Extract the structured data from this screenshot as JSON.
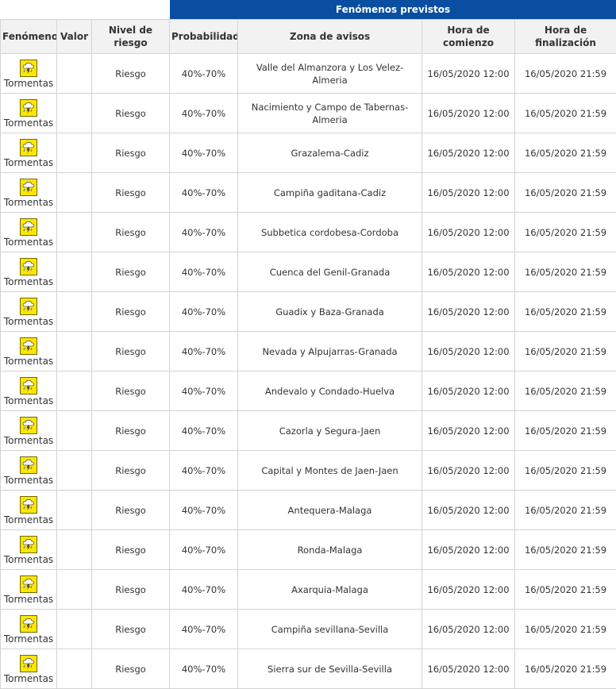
{
  "banner": {
    "title": "Fenómenos previstos"
  },
  "headers": {
    "fenomeno": "Fenómeno",
    "valor": "Valor",
    "nivel": "Nivel de riesgo",
    "probabilidad": "Probabilidad",
    "zona": "Zona de avisos",
    "comienzo": "Hora de comienzo",
    "finalizacion": "Hora de finalización"
  },
  "icon": {
    "name": "storm-icon",
    "color": "#ffe600"
  },
  "rows": [
    {
      "fenomeno": "Tormentas",
      "valor": "",
      "nivel": "Riesgo",
      "probabilidad": "40%-70%",
      "zona": "Valle del Almanzora y Los Velez-Almeria",
      "comienzo": "16/05/2020 12:00",
      "fin": "16/05/2020 21:59"
    },
    {
      "fenomeno": "Tormentas",
      "valor": "",
      "nivel": "Riesgo",
      "probabilidad": "40%-70%",
      "zona": "Nacimiento y Campo de Tabernas-Almeria",
      "comienzo": "16/05/2020 12:00",
      "fin": "16/05/2020 21:59"
    },
    {
      "fenomeno": "Tormentas",
      "valor": "",
      "nivel": "Riesgo",
      "probabilidad": "40%-70%",
      "zona": "Grazalema-Cadiz",
      "comienzo": "16/05/2020 12:00",
      "fin": "16/05/2020 21:59"
    },
    {
      "fenomeno": "Tormentas",
      "valor": "",
      "nivel": "Riesgo",
      "probabilidad": "40%-70%",
      "zona": "Campiña gaditana-Cadiz",
      "comienzo": "16/05/2020 12:00",
      "fin": "16/05/2020 21:59"
    },
    {
      "fenomeno": "Tormentas",
      "valor": "",
      "nivel": "Riesgo",
      "probabilidad": "40%-70%",
      "zona": "Subbetica cordobesa-Cordoba",
      "comienzo": "16/05/2020 12:00",
      "fin": "16/05/2020 21:59"
    },
    {
      "fenomeno": "Tormentas",
      "valor": "",
      "nivel": "Riesgo",
      "probabilidad": "40%-70%",
      "zona": "Cuenca del Genil-Granada",
      "comienzo": "16/05/2020 12:00",
      "fin": "16/05/2020 21:59"
    },
    {
      "fenomeno": "Tormentas",
      "valor": "",
      "nivel": "Riesgo",
      "probabilidad": "40%-70%",
      "zona": "Guadix y Baza-Granada",
      "comienzo": "16/05/2020 12:00",
      "fin": "16/05/2020 21:59"
    },
    {
      "fenomeno": "Tormentas",
      "valor": "",
      "nivel": "Riesgo",
      "probabilidad": "40%-70%",
      "zona": "Nevada y Alpujarras-Granada",
      "comienzo": "16/05/2020 12:00",
      "fin": "16/05/2020 21:59"
    },
    {
      "fenomeno": "Tormentas",
      "valor": "",
      "nivel": "Riesgo",
      "probabilidad": "40%-70%",
      "zona": "Andevalo y Condado-Huelva",
      "comienzo": "16/05/2020 12:00",
      "fin": "16/05/2020 21:59"
    },
    {
      "fenomeno": "Tormentas",
      "valor": "",
      "nivel": "Riesgo",
      "probabilidad": "40%-70%",
      "zona": "Cazorla y Segura-Jaen",
      "comienzo": "16/05/2020 12:00",
      "fin": "16/05/2020 21:59"
    },
    {
      "fenomeno": "Tormentas",
      "valor": "",
      "nivel": "Riesgo",
      "probabilidad": "40%-70%",
      "zona": "Capital y Montes de Jaen-Jaen",
      "comienzo": "16/05/2020 12:00",
      "fin": "16/05/2020 21:59"
    },
    {
      "fenomeno": "Tormentas",
      "valor": "",
      "nivel": "Riesgo",
      "probabilidad": "40%-70%",
      "zona": "Antequera-Malaga",
      "comienzo": "16/05/2020 12:00",
      "fin": "16/05/2020 21:59"
    },
    {
      "fenomeno": "Tormentas",
      "valor": "",
      "nivel": "Riesgo",
      "probabilidad": "40%-70%",
      "zona": "Ronda-Malaga",
      "comienzo": "16/05/2020 12:00",
      "fin": "16/05/2020 21:59"
    },
    {
      "fenomeno": "Tormentas",
      "valor": "",
      "nivel": "Riesgo",
      "probabilidad": "40%-70%",
      "zona": "Axarquia-Malaga",
      "comienzo": "16/05/2020 12:00",
      "fin": "16/05/2020 21:59"
    },
    {
      "fenomeno": "Tormentas",
      "valor": "",
      "nivel": "Riesgo",
      "probabilidad": "40%-70%",
      "zona": "Campiña sevillana-Sevilla",
      "comienzo": "16/05/2020 12:00",
      "fin": "16/05/2020 21:59"
    },
    {
      "fenomeno": "Tormentas",
      "valor": "",
      "nivel": "Riesgo",
      "probabilidad": "40%-70%",
      "zona": "Sierra sur de Sevilla-Sevilla",
      "comienzo": "16/05/2020 12:00",
      "fin": "16/05/2020 21:59"
    }
  ]
}
